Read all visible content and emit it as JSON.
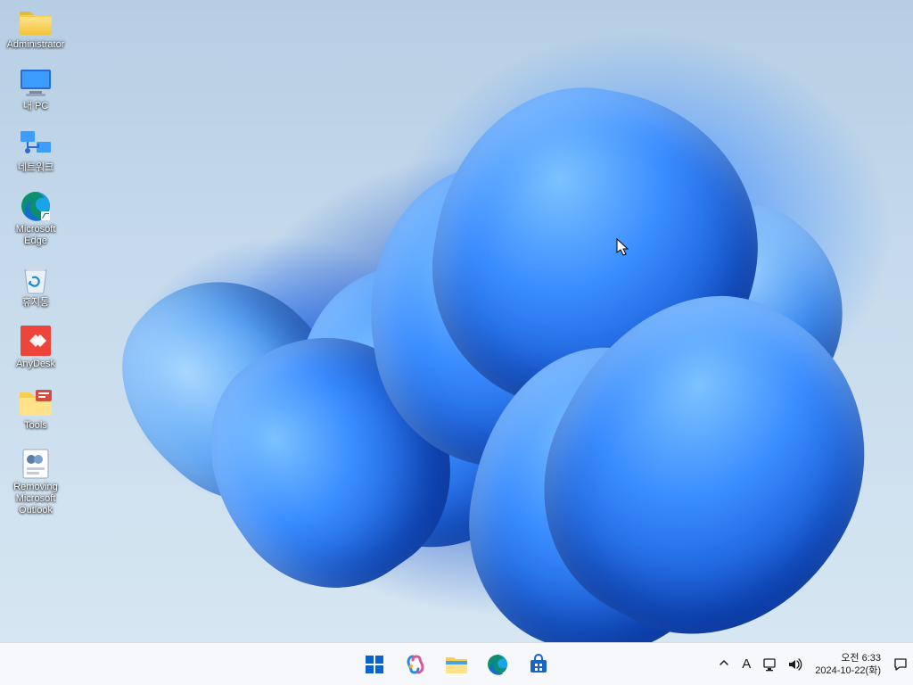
{
  "desktop": {
    "icons": [
      {
        "id": "admin",
        "label": "Administrator",
        "icon": "folder"
      },
      {
        "id": "mypc",
        "label": "내 PC",
        "icon": "pc"
      },
      {
        "id": "network",
        "label": "네트워크",
        "icon": "network"
      },
      {
        "id": "edge",
        "label": "Microsoft\nEdge",
        "icon": "edge"
      },
      {
        "id": "recycle",
        "label": "휴지통",
        "icon": "recycle"
      },
      {
        "id": "anydesk",
        "label": "AnyDesk",
        "icon": "anydesk"
      },
      {
        "id": "tools",
        "label": "Tools",
        "icon": "folder-tools"
      },
      {
        "id": "remove",
        "label": "Removing\nMicrosoft\nOutlook",
        "icon": "bat"
      }
    ]
  },
  "taskbar": {
    "pinned": [
      {
        "id": "start",
        "name": "start-button",
        "icon": "winlogo"
      },
      {
        "id": "copilot",
        "name": "copilot-button",
        "icon": "copilot"
      },
      {
        "id": "explorer",
        "name": "file-explorer-button",
        "icon": "explorer"
      },
      {
        "id": "edgetb",
        "name": "edge-button",
        "icon": "edge-tb"
      },
      {
        "id": "store",
        "name": "microsoft-store-button",
        "icon": "store"
      }
    ]
  },
  "tray": {
    "overflow_glyph": "^",
    "ime_glyph": "A",
    "time": "오전 6:33",
    "date": "2024-10-22(화)"
  }
}
